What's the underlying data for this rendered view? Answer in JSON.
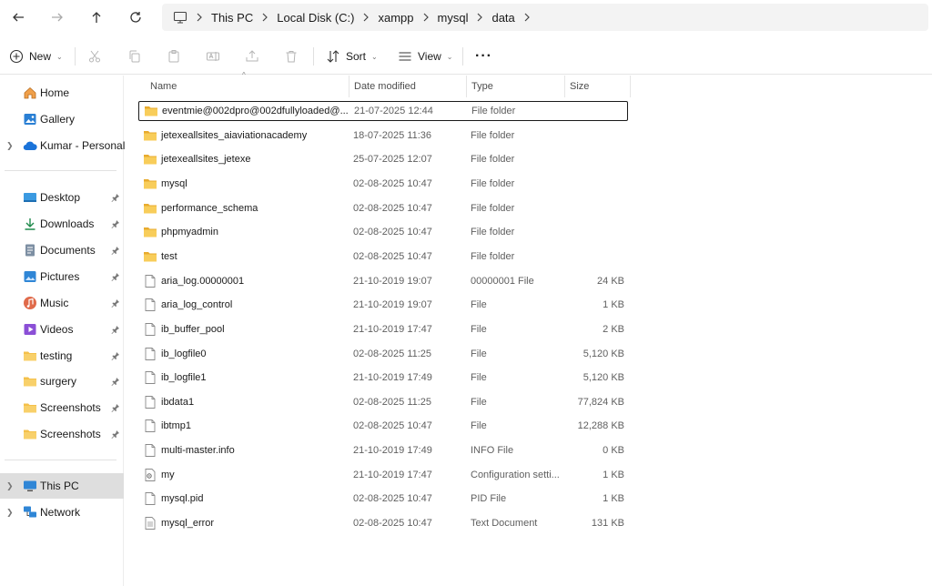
{
  "nav": {
    "back_icon": "arrow-left-icon",
    "forward_icon": "arrow-right-icon",
    "up_icon": "arrow-up-icon",
    "refresh_icon": "refresh-icon"
  },
  "breadcrumb": [
    "This PC",
    "Local Disk (C:)",
    "xampp",
    "mysql",
    "data"
  ],
  "toolbar": {
    "new_label": "New",
    "sort_label": "Sort",
    "view_label": "View",
    "more_label": "···"
  },
  "sidebar": {
    "items": [
      {
        "label": "Home",
        "icon": "home-icon"
      },
      {
        "label": "Gallery",
        "icon": "gallery-icon"
      },
      {
        "label": "Kumar - Personal",
        "icon": "onedrive-cloud-icon"
      },
      {
        "label": "Desktop",
        "icon": "desktop-icon"
      },
      {
        "label": "Downloads",
        "icon": "download-icon"
      },
      {
        "label": "Documents",
        "icon": "documents-icon"
      },
      {
        "label": "Pictures",
        "icon": "pictures-icon"
      },
      {
        "label": "Music",
        "icon": "music-icon"
      },
      {
        "label": "Videos",
        "icon": "videos-icon"
      },
      {
        "label": "testing",
        "icon": "folder-icon"
      },
      {
        "label": "surgery",
        "icon": "folder-icon"
      },
      {
        "label": "Screenshots",
        "icon": "folder-icon"
      },
      {
        "label": "Screenshots",
        "icon": "folder-icon"
      },
      {
        "label": "This PC",
        "icon": "computer-icon"
      },
      {
        "label": "Network",
        "icon": "network-icon"
      }
    ]
  },
  "columns": {
    "name": "Name",
    "date": "Date modified",
    "type": "Type",
    "size": "Size"
  },
  "files": [
    {
      "name": "eventmie@002dpro@002dfullyloaded@...",
      "date": "21-07-2025 12:44",
      "type": "File folder",
      "size": "",
      "icon": "folder-icon"
    },
    {
      "name": "jetexeallsites_aiaviationacademy",
      "date": "18-07-2025 11:36",
      "type": "File folder",
      "size": "",
      "icon": "folder-icon"
    },
    {
      "name": "jetexeallsites_jetexe",
      "date": "25-07-2025 12:07",
      "type": "File folder",
      "size": "",
      "icon": "folder-icon"
    },
    {
      "name": "mysql",
      "date": "02-08-2025 10:47",
      "type": "File folder",
      "size": "",
      "icon": "folder-icon"
    },
    {
      "name": "performance_schema",
      "date": "02-08-2025 10:47",
      "type": "File folder",
      "size": "",
      "icon": "folder-icon"
    },
    {
      "name": "phpmyadmin",
      "date": "02-08-2025 10:47",
      "type": "File folder",
      "size": "",
      "icon": "folder-icon"
    },
    {
      "name": "test",
      "date": "02-08-2025 10:47",
      "type": "File folder",
      "size": "",
      "icon": "folder-icon"
    },
    {
      "name": "aria_log.00000001",
      "date": "21-10-2019 19:07",
      "type": "00000001 File",
      "size": "24 KB",
      "icon": "file-icon"
    },
    {
      "name": "aria_log_control",
      "date": "21-10-2019 19:07",
      "type": "File",
      "size": "1 KB",
      "icon": "file-icon"
    },
    {
      "name": "ib_buffer_pool",
      "date": "21-10-2019 17:47",
      "type": "File",
      "size": "2 KB",
      "icon": "file-icon"
    },
    {
      "name": "ib_logfile0",
      "date": "02-08-2025 11:25",
      "type": "File",
      "size": "5,120 KB",
      "icon": "file-icon"
    },
    {
      "name": "ib_logfile1",
      "date": "21-10-2019 17:49",
      "type": "File",
      "size": "5,120 KB",
      "icon": "file-icon"
    },
    {
      "name": "ibdata1",
      "date": "02-08-2025 11:25",
      "type": "File",
      "size": "77,824 KB",
      "icon": "file-icon"
    },
    {
      "name": "ibtmp1",
      "date": "02-08-2025 10:47",
      "type": "File",
      "size": "12,288 KB",
      "icon": "file-icon"
    },
    {
      "name": "multi-master.info",
      "date": "21-10-2019 17:49",
      "type": "INFO File",
      "size": "0 KB",
      "icon": "file-icon"
    },
    {
      "name": "my",
      "date": "21-10-2019 17:47",
      "type": "Configuration setti...",
      "size": "1 KB",
      "icon": "config-file-icon"
    },
    {
      "name": "mysql.pid",
      "date": "02-08-2025 10:47",
      "type": "PID File",
      "size": "1 KB",
      "icon": "file-icon"
    },
    {
      "name": "mysql_error",
      "date": "02-08-2025 10:47",
      "type": "Text Document",
      "size": "131 KB",
      "icon": "text-document-icon"
    }
  ],
  "colors": {
    "folder": "#f4c04a",
    "selected_bg": "#dedede",
    "address_bg": "#f3f3f3"
  }
}
